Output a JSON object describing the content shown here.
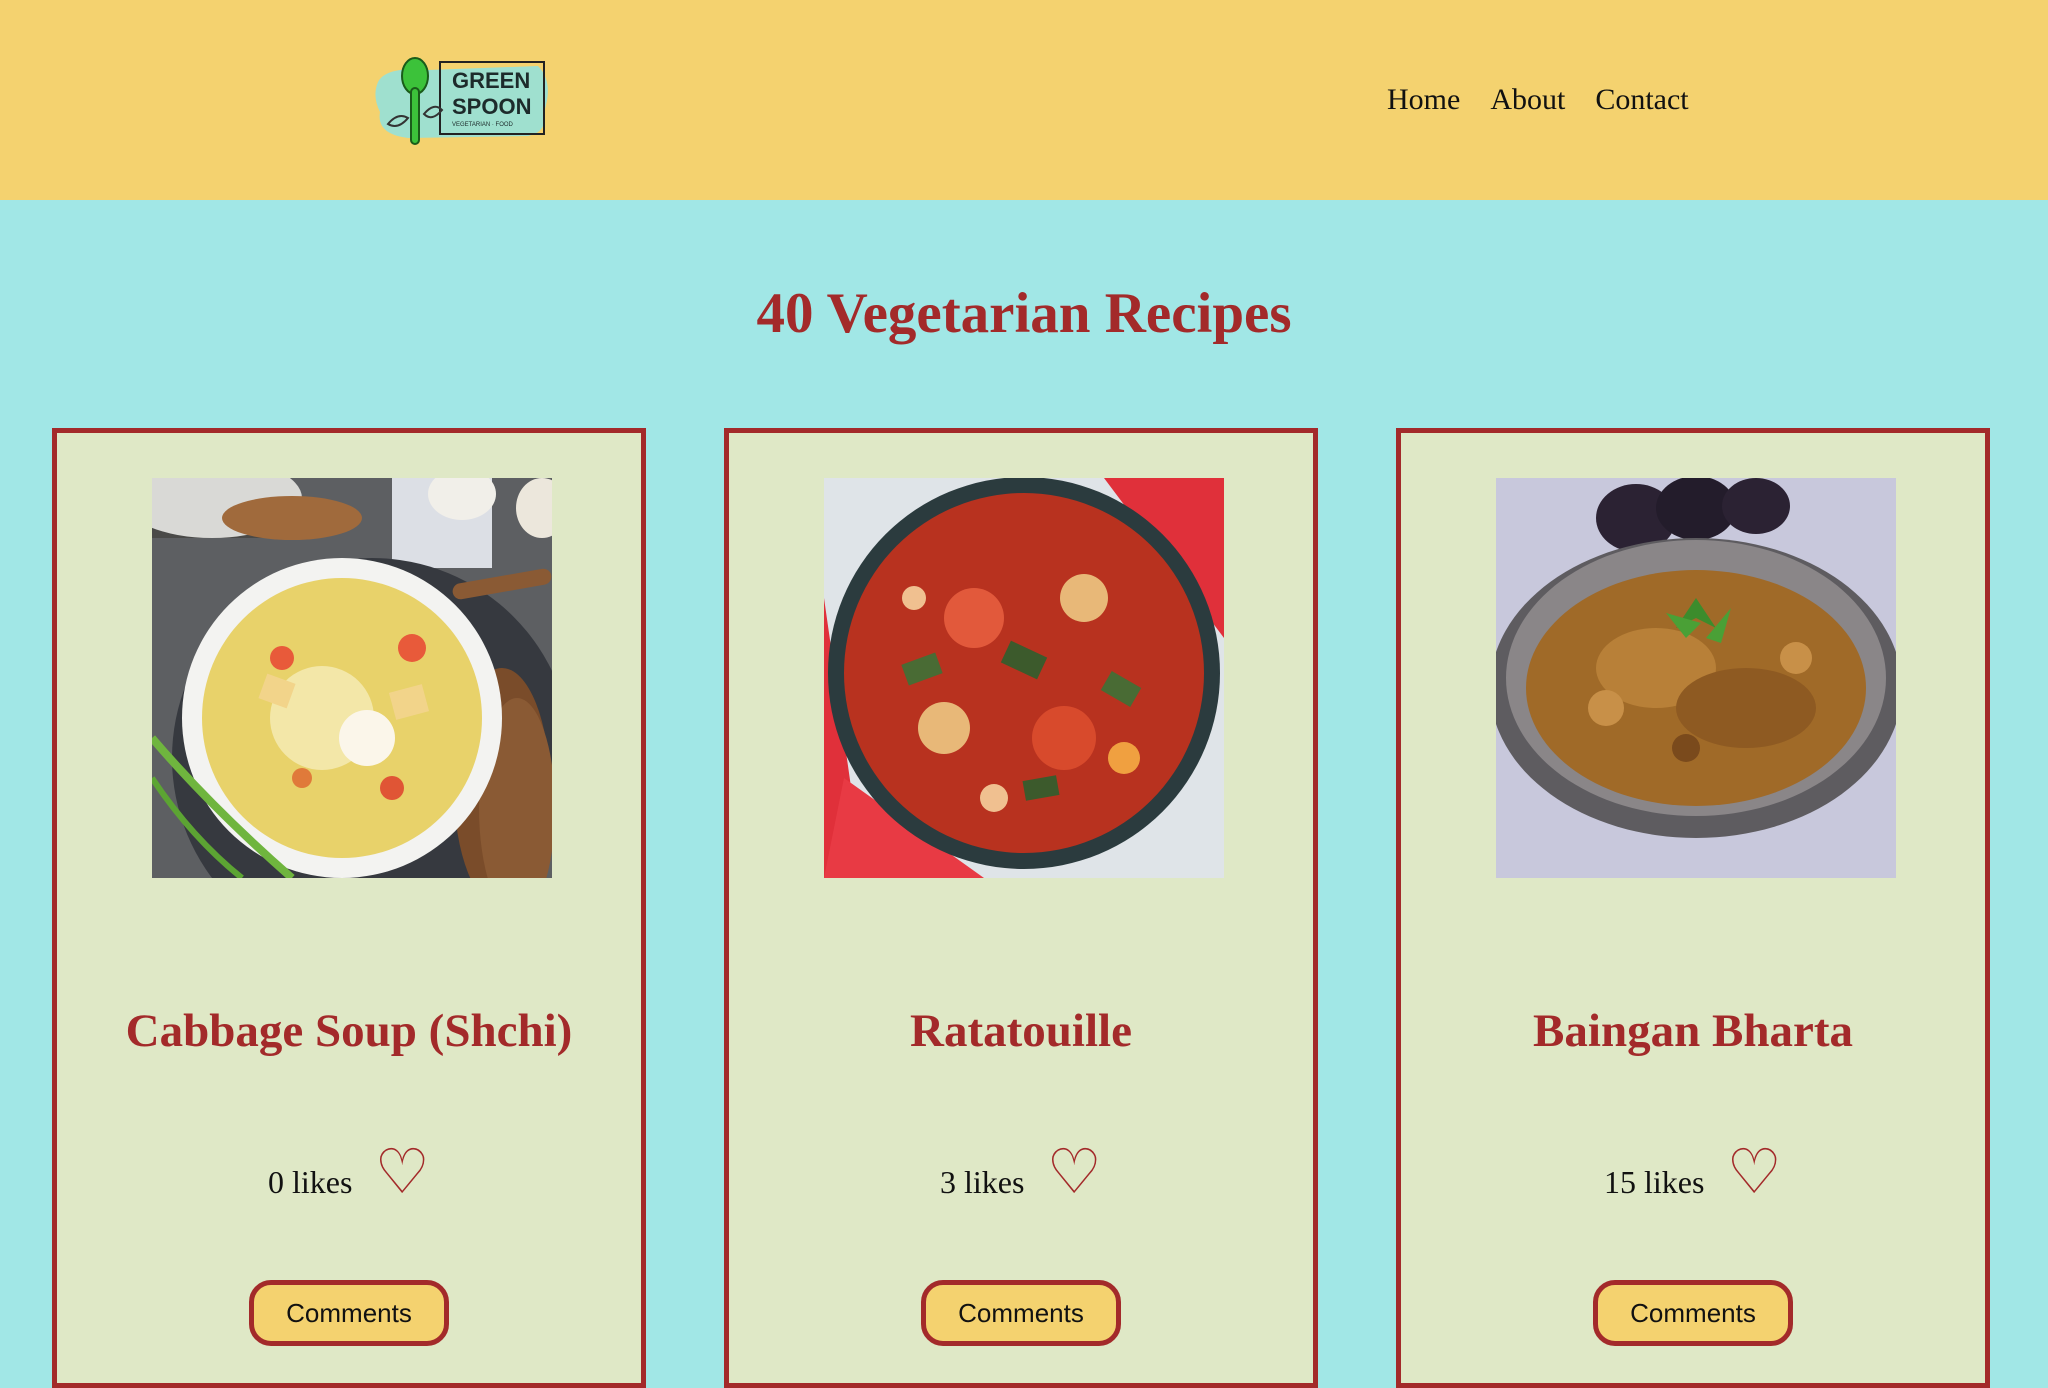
{
  "header": {
    "logo": {
      "line1": "GREEN",
      "line2": "SPOON",
      "tagline": "VEGETARIAN · FOOD"
    },
    "nav": [
      {
        "label": "Home"
      },
      {
        "label": "About"
      },
      {
        "label": "Contact"
      }
    ]
  },
  "page": {
    "title": "40 Vegetarian Recipes"
  },
  "recipes": [
    {
      "title": "Cabbage Soup (Shchi)",
      "likes": "0 likes",
      "comments_label": "Comments"
    },
    {
      "title": "Ratatouille",
      "likes": "3 likes",
      "comments_label": "Comments"
    },
    {
      "title": "Baingan Bharta",
      "likes": "15 likes",
      "comments_label": "Comments"
    }
  ],
  "icons": {
    "like": "heart-outline-icon"
  },
  "colors": {
    "header_bg": "#f4d26f",
    "page_bg": "#a1e7e6",
    "card_bg": "#dfe8c6",
    "accent": "#a32a2a",
    "logo_green": "#3cc23a"
  }
}
